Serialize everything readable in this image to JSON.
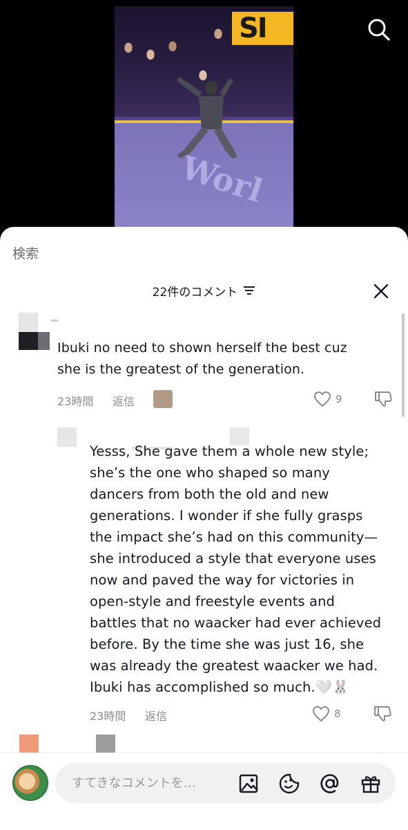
{
  "video": {
    "banner_text": "SI",
    "floor_text": "Worl"
  },
  "sheet": {
    "search_label": "検索",
    "header_title": "22件のコメント"
  },
  "comments": [
    {
      "text_line1": "Ibuki no need to shown herself the best cuz",
      "text_line2": "she is the greatest of the generation.",
      "time": "23時間",
      "reply_label": "返信",
      "likes": "9"
    },
    {
      "lines": [
        "Yesss, She gave them a whole new style;",
        "she’s the one who shaped so many",
        "dancers from both the old and new",
        "generations. I wonder if she fully grasps",
        "the impact she’s had on this community—",
        "she introduced a style that everyone uses",
        "now and paved the way for victories in",
        "open-style and freestyle events and",
        "battles that no waacker had ever achieved",
        "before. By the time she was just 16, she",
        "was already the greatest waacker we had.",
        "Ibuki has accomplished so much.🤍🐰"
      ],
      "time": "23時間",
      "reply_label": "返信",
      "likes": "8"
    }
  ],
  "input": {
    "placeholder": "すてきなコメントを…"
  },
  "colors": {
    "text": "#161823",
    "muted": "#8a8b91",
    "pill_bg": "#f1f1f2"
  }
}
